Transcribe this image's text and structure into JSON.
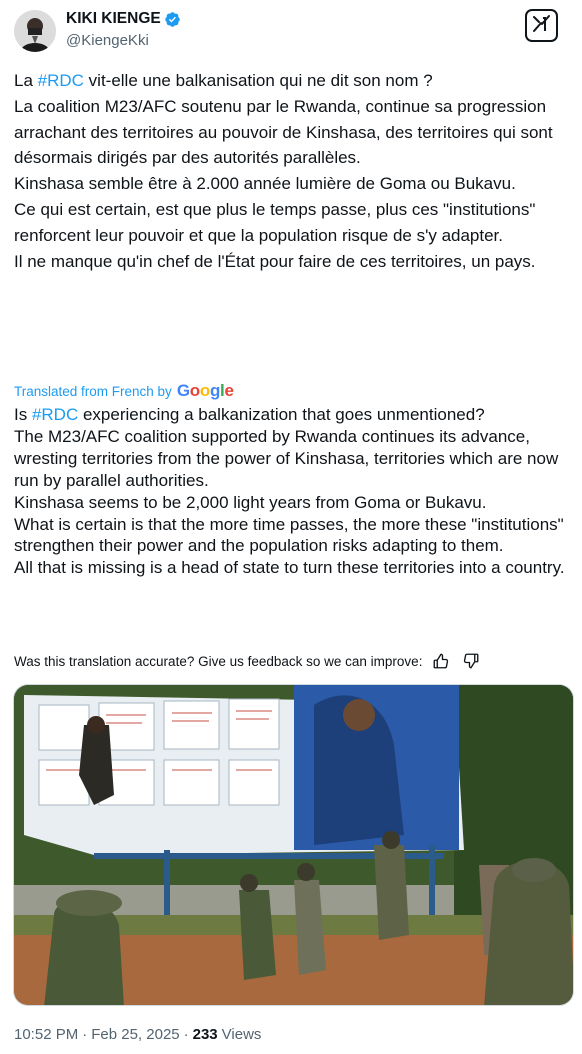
{
  "author": {
    "name": "KIKI KIENGE",
    "handle": "@KiengeKki"
  },
  "tweet": {
    "paragraphs": [
      {
        "before": "La ",
        "hashtag": "#RDC",
        "after": " vit-elle une balkanisation qui ne dit son nom ?"
      },
      {
        "before": "La coalition M23/AFC soutenu par  le Rwanda, continue sa progression arrachant des territoires au pouvoir de Kinshasa, des territoires qui sont désormais dirigés par des autorités parallèles.",
        "hashtag": "",
        "after": ""
      },
      {
        "before": "Kinshasa semble être à 2.000 année lumière de Goma ou Bukavu.",
        "hashtag": "",
        "after": ""
      },
      {
        "before": "Ce qui est certain, est que plus le temps passe, plus ces \"institutions\" renforcent leur pouvoir et que la population risque de s'y adapter.",
        "hashtag": "",
        "after": ""
      },
      {
        "before": "Il ne manque qu'in chef de l'État pour faire de ces territoires, un pays.",
        "hashtag": "",
        "after": ""
      }
    ]
  },
  "translation": {
    "label": "Translated from French by",
    "logo": "Google",
    "paragraphs": [
      {
        "before": "Is ",
        "hashtag": "#RDC",
        "after": " experiencing a balkanization that goes unmentioned?"
      },
      {
        "before": "The M23/AFC coalition supported by Rwanda continues its advance, wresting territories from the power of Kinshasa, territories which are now run by parallel authorities.",
        "hashtag": "",
        "after": ""
      },
      {
        "before": "Kinshasa seems to be 2,000 light years from Goma or Bukavu.",
        "hashtag": "",
        "after": ""
      },
      {
        "before": "What is certain is that the more time passes, the more these \"institutions\" strengthen their power and the population risks adapting to them.",
        "hashtag": "",
        "after": ""
      },
      {
        "before": "All that is missing is a head of state to turn these territories into a country.",
        "hashtag": "",
        "after": ""
      }
    ],
    "feedback": "Was this translation accurate? Give us feedback so we can improve:"
  },
  "meta": {
    "time": "10:52 PM",
    "separator": "·",
    "date": "Feb 25, 2025",
    "views_count": "233",
    "views_label": "Views"
  },
  "icons": {
    "verified": "verified-badge-icon",
    "grok": "grok-icon",
    "thumbs_up": "thumbs-up-icon",
    "thumbs_down": "thumbs-down-icon"
  },
  "colors": {
    "accent": "#1d9bf0",
    "text": "#0f1419",
    "muted": "#536471"
  }
}
